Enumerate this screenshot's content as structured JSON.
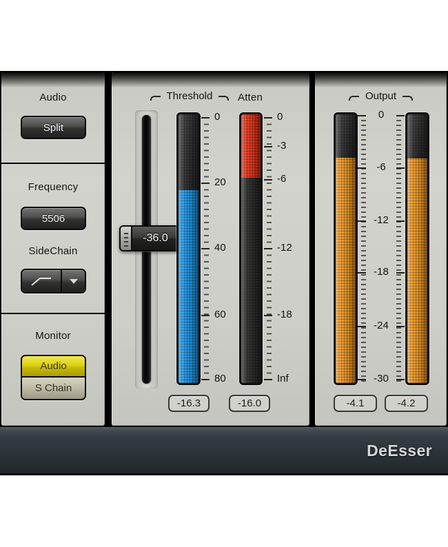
{
  "window": {
    "title": "DeEsser"
  },
  "colors": {
    "meter_blue": "#1f97e8",
    "meter_red": "#e8371c",
    "meter_orange": "#f09a26",
    "meter_dark": "#2e2e2c",
    "monitor_active_yellow": "#ddd012",
    "panel_gray": "#cdcdc7"
  },
  "left_panel": {
    "audio_section": {
      "label": "Audio",
      "split_button": "Split"
    },
    "frequency_section": {
      "label": "Frequency",
      "frequency_value": "5506",
      "sidechain_label": "SideChain",
      "filter_icon": "highpass-filter-icon",
      "dropdown_icon": "chevron-down-icon"
    },
    "monitor_section": {
      "label": "Monitor",
      "audio_button": "Audio",
      "schain_button": "S Chain"
    }
  },
  "threshold": {
    "label": "Threshold",
    "slider_value": "-36.0",
    "readout": "-16.3",
    "scale": [
      "0",
      "20",
      "40",
      "60",
      "80"
    ],
    "meter_signal_top_pct": 28.3
  },
  "atten": {
    "label": "Atten",
    "readout": "-16.0",
    "scale": [
      "0",
      "-3",
      "-6",
      "-12",
      "-18",
      "Inf"
    ],
    "meter_signal_top_pct": 23.7
  },
  "output": {
    "label": "Output",
    "left_readout": "-4.1",
    "right_readout": "-4.2",
    "scale": [
      "0",
      "-6",
      "-12",
      "-18",
      "-24",
      "-30"
    ],
    "left_meter_signal_top_pct": 16.2,
    "right_meter_signal_top_pct": 16.4
  }
}
